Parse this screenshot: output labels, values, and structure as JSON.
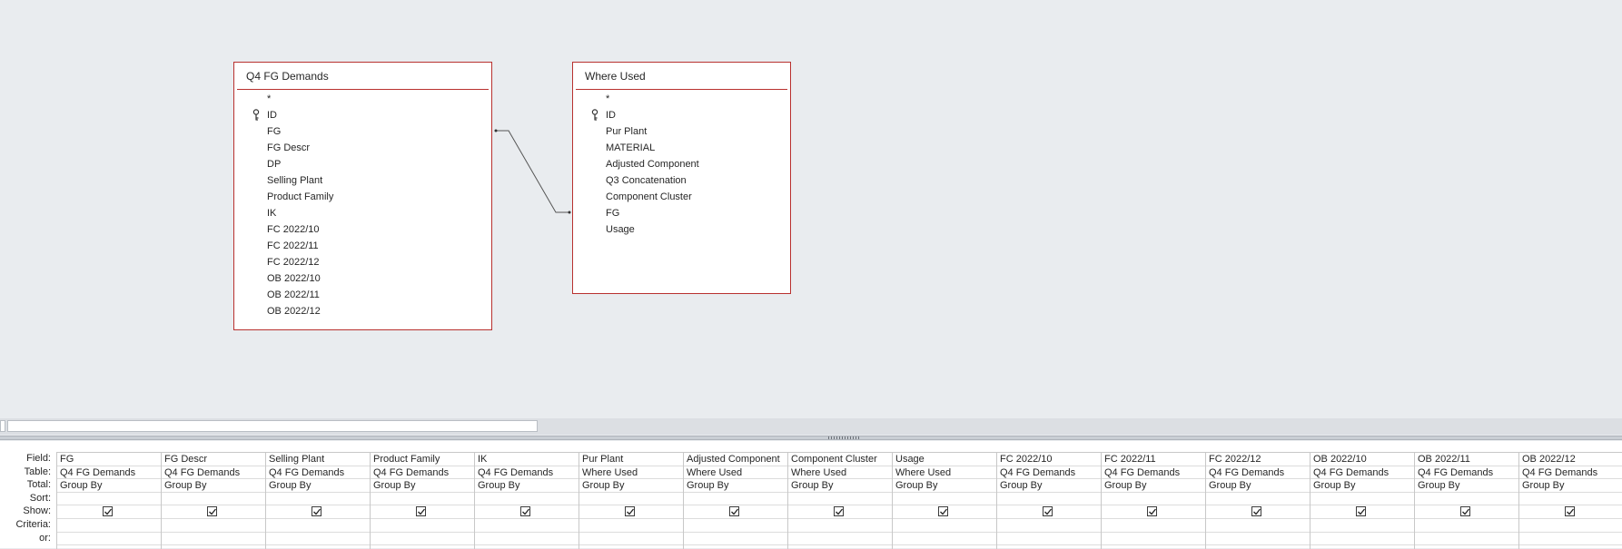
{
  "tables": [
    {
      "title": "Q4 FG Demands",
      "fields": [
        {
          "name": "*",
          "key": false
        },
        {
          "name": "ID",
          "key": true
        },
        {
          "name": "FG",
          "key": false
        },
        {
          "name": "FG Descr",
          "key": false
        },
        {
          "name": "DP",
          "key": false
        },
        {
          "name": "Selling Plant",
          "key": false
        },
        {
          "name": "Product Family",
          "key": false
        },
        {
          "name": "IK",
          "key": false
        },
        {
          "name": "FC 2022/10",
          "key": false
        },
        {
          "name": "FC 2022/11",
          "key": false
        },
        {
          "name": "FC 2022/12",
          "key": false
        },
        {
          "name": "OB 2022/10",
          "key": false
        },
        {
          "name": "OB 2022/11",
          "key": false
        },
        {
          "name": "OB 2022/12",
          "key": false
        }
      ]
    },
    {
      "title": "Where Used",
      "fields": [
        {
          "name": "*",
          "key": false
        },
        {
          "name": "ID",
          "key": true
        },
        {
          "name": "Pur Plant",
          "key": false
        },
        {
          "name": "MATERIAL",
          "key": false
        },
        {
          "name": "Adjusted Component",
          "key": false
        },
        {
          "name": "Q3 Concatenation",
          "key": false
        },
        {
          "name": "Component Cluster",
          "key": false
        },
        {
          "name": "FG",
          "key": false
        },
        {
          "name": "Usage",
          "key": false
        }
      ]
    }
  ],
  "relationship": {
    "from_table": "Q4 FG Demands",
    "from_field": "FG",
    "to_table": "Where Used",
    "to_field": "FG"
  },
  "grid": {
    "row_labels": [
      "Field:",
      "Table:",
      "Total:",
      "Sort:",
      "Show:",
      "Criteria:",
      "or:"
    ],
    "columns": [
      {
        "field": "FG",
        "table": "Q4 FG Demands",
        "total": "Group By",
        "sort": "",
        "show": true
      },
      {
        "field": "FG Descr",
        "table": "Q4 FG Demands",
        "total": "Group By",
        "sort": "",
        "show": true
      },
      {
        "field": "Selling Plant",
        "table": "Q4 FG Demands",
        "total": "Group By",
        "sort": "",
        "show": true
      },
      {
        "field": "Product Family",
        "table": "Q4 FG Demands",
        "total": "Group By",
        "sort": "",
        "show": true
      },
      {
        "field": "IK",
        "table": "Q4 FG Demands",
        "total": "Group By",
        "sort": "",
        "show": true
      },
      {
        "field": "Pur Plant",
        "table": "Where Used",
        "total": "Group By",
        "sort": "",
        "show": true
      },
      {
        "field": "Adjusted Component",
        "table": "Where Used",
        "total": "Group By",
        "sort": "",
        "show": true
      },
      {
        "field": "Component Cluster",
        "table": "Where Used",
        "total": "Group By",
        "sort": "",
        "show": true
      },
      {
        "field": "Usage",
        "table": "Where Used",
        "total": "Group By",
        "sort": "",
        "show": true
      },
      {
        "field": "FC 2022/10",
        "table": "Q4 FG Demands",
        "total": "Group By",
        "sort": "",
        "show": true
      },
      {
        "field": "FC 2022/11",
        "table": "Q4 FG Demands",
        "total": "Group By",
        "sort": "",
        "show": true
      },
      {
        "field": "FC 2022/12",
        "table": "Q4 FG Demands",
        "total": "Group By",
        "sort": "",
        "show": true
      },
      {
        "field": "OB 2022/10",
        "table": "Q4 FG Demands",
        "total": "Group By",
        "sort": "",
        "show": true
      },
      {
        "field": "OB 2022/11",
        "table": "Q4 FG Demands",
        "total": "Group By",
        "sort": "",
        "show": true
      },
      {
        "field": "OB 2022/12",
        "table": "Q4 FG Demands",
        "total": "Group By",
        "sort": "",
        "show": true
      }
    ]
  },
  "colors": {
    "table_border": "#b8312f",
    "background": "#e9ecef"
  }
}
